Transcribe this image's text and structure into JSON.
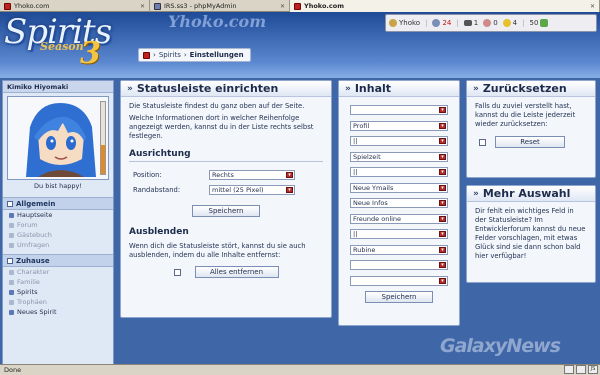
{
  "browser": {
    "tabs": [
      {
        "label": "Yhoko.com",
        "active": false
      },
      {
        "label": "IRS.ss3 - phpMyAdmin",
        "active": false
      },
      {
        "label": "Yhoko.com",
        "active": true
      }
    ],
    "status_text": "Done",
    "status_icons": [
      "JS"
    ]
  },
  "header": {
    "logo_text": "Spirits",
    "season_label": "Season",
    "season_number": "3",
    "brand_text": "Yhoko.com"
  },
  "userbar": {
    "username": "Yhoko",
    "time_value": "24",
    "mail_value": "1",
    "msg_value": "0",
    "gold_value": "4",
    "score_value": "50"
  },
  "breadcrumb": {
    "section": "Spirits",
    "current": "Einstellungen"
  },
  "sidebar": {
    "profile_name": "Kimiko Hiyomaki",
    "status": "Du bist happy!",
    "sections": [
      {
        "title": "Allgemein",
        "items": [
          {
            "label": "Hauptseite",
            "enabled": true
          },
          {
            "label": "Forum",
            "enabled": false
          },
          {
            "label": "Gästebuch",
            "enabled": false
          },
          {
            "label": "Umfragen",
            "enabled": false
          }
        ]
      },
      {
        "title": "Zuhause",
        "items": [
          {
            "label": "Charakter",
            "enabled": false
          },
          {
            "label": "Familie",
            "enabled": false
          },
          {
            "label": "Spirits",
            "enabled": true
          },
          {
            "label": "Trophäen",
            "enabled": false
          },
          {
            "label": "Neues Spirit",
            "enabled": true
          }
        ]
      }
    ]
  },
  "main_panel": {
    "title": "Statusleiste einrichten",
    "intro1": "Die Statusleiste findest du ganz oben auf der Seite.",
    "intro2": "Welche Informationen dort in welcher Reihenfolge angezeigt werden, kannst du in der Liste rechts selbst festlegen.",
    "ausrichtung_heading": "Ausrichtung",
    "position_label": "Position:",
    "position_value": "Rechts",
    "randabstand_label": "Randabstand:",
    "randabstand_value": "mittel (25 Pixel)",
    "save_label": "Speichern",
    "ausblenden_heading": "Ausblenden",
    "ausblenden_text": "Wenn dich die Statusleiste stört, kannst du sie auch ausblenden, indem du alle Inhalte entfernst:",
    "remove_all_label": "Alles entfernen"
  },
  "inhalt_panel": {
    "title": "Inhalt",
    "slots": [
      "",
      "Profil",
      "||",
      "Spielzeit",
      "||",
      "Neue Ymails",
      "Neue Infos",
      "Freunde online",
      "||",
      "Rubine",
      "",
      ""
    ],
    "save_label": "Speichern"
  },
  "reset_panel": {
    "title": "Zurücksetzen",
    "text": "Falls du zuviel verstellt hast, kannst du die Leiste jederzeit wieder zurücksetzen:",
    "reset_label": "Reset"
  },
  "mehr_panel": {
    "title": "Mehr Auswahl",
    "text": "Dir fehlt ein wichtiges Feld in der Statusleiste? Im Entwicklerforum kannst du neue Felder vorschlagen, mit etwas Glück sind sie dann schon bald hier verfügbar!"
  },
  "watermark": "GalaxyNews",
  "colors": {
    "accent": "#3f66a6",
    "panel_bg": "#f3f6fb",
    "select_arrow": "#b22d2d"
  }
}
